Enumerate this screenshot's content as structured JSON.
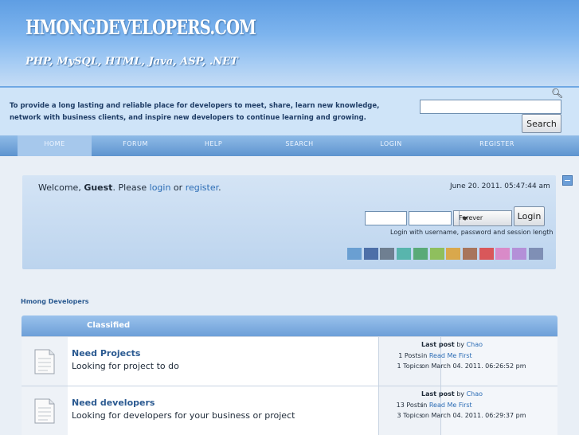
{
  "header": {
    "site_title": "HMONGDEVELOPERS.COM",
    "subtitle": "PHP, MySQL, HTML, Java, ASP, .NET",
    "mission": "To provide a long lasting and reliable place for developers to meet, share, learn new knowledge, network with business clients, and inspire new developers to continue learning and growing.",
    "search_button": "Search",
    "search_value": ""
  },
  "nav": [
    "HOME",
    "FORUM",
    "HELP",
    "SEARCH",
    "LOGIN",
    "REGISTER"
  ],
  "userbox": {
    "welcome_prefix": "Welcome, ",
    "guest": "Guest",
    "please": ". Please ",
    "login_link": "login",
    "or": " or ",
    "register_link": "register",
    "end": ".",
    "date": "June 20. 2011. 05:47:44 am",
    "session_option": "Forever",
    "login_button": "Login",
    "login_hint": "Login with username, password and session length",
    "theme_colors": [
      "#6a9fd2",
      "#4d6fa8",
      "#6f7f91",
      "#58b5ad",
      "#5aaa78",
      "#8fbf5d",
      "#d9a84c",
      "#a8755c",
      "#d9575a",
      "#d98ac8",
      "#b490d8",
      "#7f8fb5"
    ]
  },
  "breadcrumb": "Hmong Developers",
  "category": {
    "title": "Classified",
    "boards": [
      {
        "name": "Need Projects",
        "desc": "Looking for project to do",
        "posts": "1 Posts",
        "topics": "1 Topics",
        "lp_label": "Last post",
        "lp_by": " by ",
        "lp_user": "Chao",
        "lp_in": "in ",
        "lp_topic": "Read Me First",
        "lp_on": "on March 04. 2011. 06:26:52 pm"
      },
      {
        "name": "Need developers",
        "desc": "Looking for developers for your business or project",
        "posts": "13 Posts",
        "topics": "3 Topics",
        "lp_label": "Last post",
        "lp_by": " by ",
        "lp_user": "Chao",
        "lp_in": "in ",
        "lp_topic": "Read Me First",
        "lp_on": "on March 04. 2011. 06:29:37 pm"
      }
    ]
  }
}
